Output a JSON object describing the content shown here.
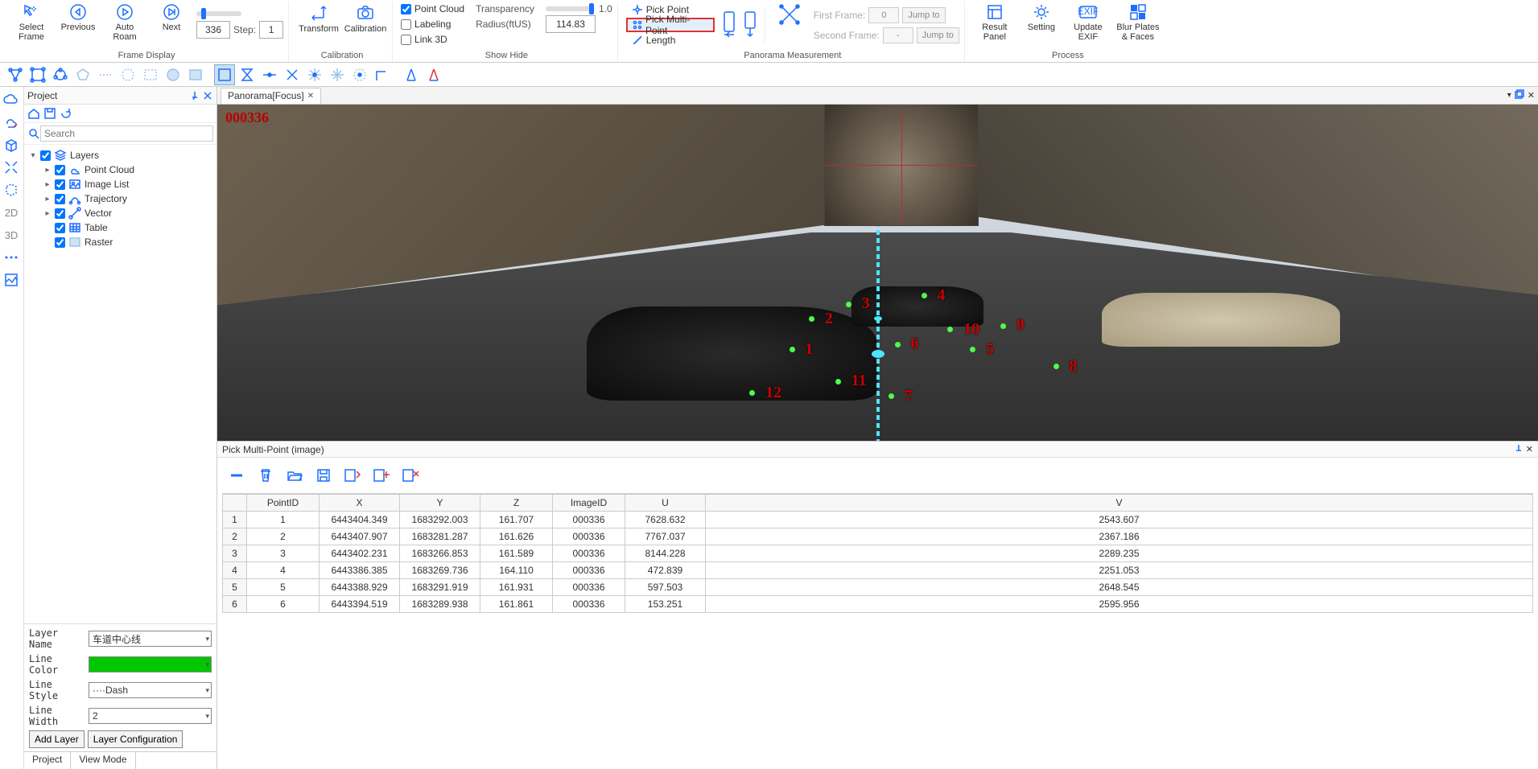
{
  "ribbon": {
    "select_frame": "Select\nFrame",
    "previous": "Previous",
    "auto_roam": "Auto\nRoam",
    "next": "Next",
    "frame_value": "336",
    "step_label": "Step:",
    "step_value": "1",
    "group_frame_display": "Frame Display",
    "transform": "Transform",
    "calibration": "Calibration",
    "group_calibration": "Calibration",
    "point_cloud": "Point Cloud",
    "transparency": "Transparency",
    "transparency_value": "1.0",
    "labeling": "Labeling",
    "radius_label": "Radius(ftUS)",
    "radius_value": "114.83",
    "link_3d": "Link 3D",
    "group_showhide": "Show Hide",
    "pick_point": "Pick Point",
    "pick_multi_point": "Pick Multi-Point",
    "length": "Length",
    "first_frame": "First Frame:",
    "second_frame": "Second Frame:",
    "ff_value": "0",
    "sf_value": "-",
    "jump_to": "Jump to",
    "group_pano_meas": "Panorama Measurement",
    "result_panel": "Result\nPanel",
    "setting": "Setting",
    "update_exif": "Update\nEXIF",
    "blur_plates": "Blur Plates\n& Faces",
    "group_process": "Process"
  },
  "project_panel": {
    "title": "Project",
    "search_placeholder": "Search",
    "layers_label": "Layers",
    "items": [
      {
        "label": "Point Cloud",
        "checked": true,
        "icon": "cloud"
      },
      {
        "label": "Image List",
        "checked": true,
        "icon": "image"
      },
      {
        "label": "Trajectory",
        "checked": true,
        "icon": "traj"
      },
      {
        "label": "Vector",
        "checked": true,
        "icon": "vector"
      },
      {
        "label": "Table",
        "checked": true,
        "icon": "table"
      },
      {
        "label": "Raster",
        "checked": true,
        "icon": "raster"
      }
    ],
    "layer_name_label": "Layer Name",
    "layer_name_value": "车道中心线",
    "line_color_label": "Line Color",
    "line_style_label": "Line Style",
    "line_style_value": "····Dash",
    "line_width_label": "Line Width",
    "line_width_value": "2",
    "add_layer": "Add Layer",
    "layer_config": "Layer Configuration",
    "tabs": {
      "project": "Project",
      "viewmode": "View Mode"
    }
  },
  "panorama": {
    "tab_title": "Panorama[Focus]",
    "frame_id": "000336",
    "points": [
      {
        "n": "1",
        "x": 44.5,
        "y": 73.0
      },
      {
        "n": "2",
        "x": 46.0,
        "y": 64.0
      },
      {
        "n": "3",
        "x": 48.8,
        "y": 59.5
      },
      {
        "n": "4",
        "x": 54.5,
        "y": 57.0
      },
      {
        "n": "5",
        "x": 58.2,
        "y": 73.0
      },
      {
        "n": "6",
        "x": 52.5,
        "y": 71.5
      },
      {
        "n": "7",
        "x": 52.0,
        "y": 87.0
      },
      {
        "n": "8",
        "x": 64.5,
        "y": 78.0
      },
      {
        "n": "9",
        "x": 60.5,
        "y": 66.0
      },
      {
        "n": "10",
        "x": 56.5,
        "y": 67.0
      },
      {
        "n": "11",
        "x": 48.0,
        "y": 82.5
      },
      {
        "n": "12",
        "x": 41.5,
        "y": 86.0
      }
    ]
  },
  "pick_panel": {
    "title": "Pick Multi-Point (image)",
    "columns": [
      "PointID",
      "X",
      "Y",
      "Z",
      "ImageID",
      "U",
      "V"
    ],
    "rows": [
      [
        "1",
        "6443404.349",
        "1683292.003",
        "161.707",
        "000336",
        "7628.632",
        "2543.607"
      ],
      [
        "2",
        "6443407.907",
        "1683281.287",
        "161.626",
        "000336",
        "7767.037",
        "2367.186"
      ],
      [
        "3",
        "6443402.231",
        "1683266.853",
        "161.589",
        "000336",
        "8144.228",
        "2289.235"
      ],
      [
        "4",
        "6443386.385",
        "1683269.736",
        "164.110",
        "000336",
        "472.839",
        "2251.053"
      ],
      [
        "5",
        "6443388.929",
        "1683291.919",
        "161.931",
        "000336",
        "597.503",
        "2648.545"
      ],
      [
        "6",
        "6443394.519",
        "1683289.938",
        "161.861",
        "000336",
        "153.251",
        "2595.956"
      ]
    ]
  },
  "leftbar": {
    "t2d": "2D",
    "t3d": "3D"
  }
}
